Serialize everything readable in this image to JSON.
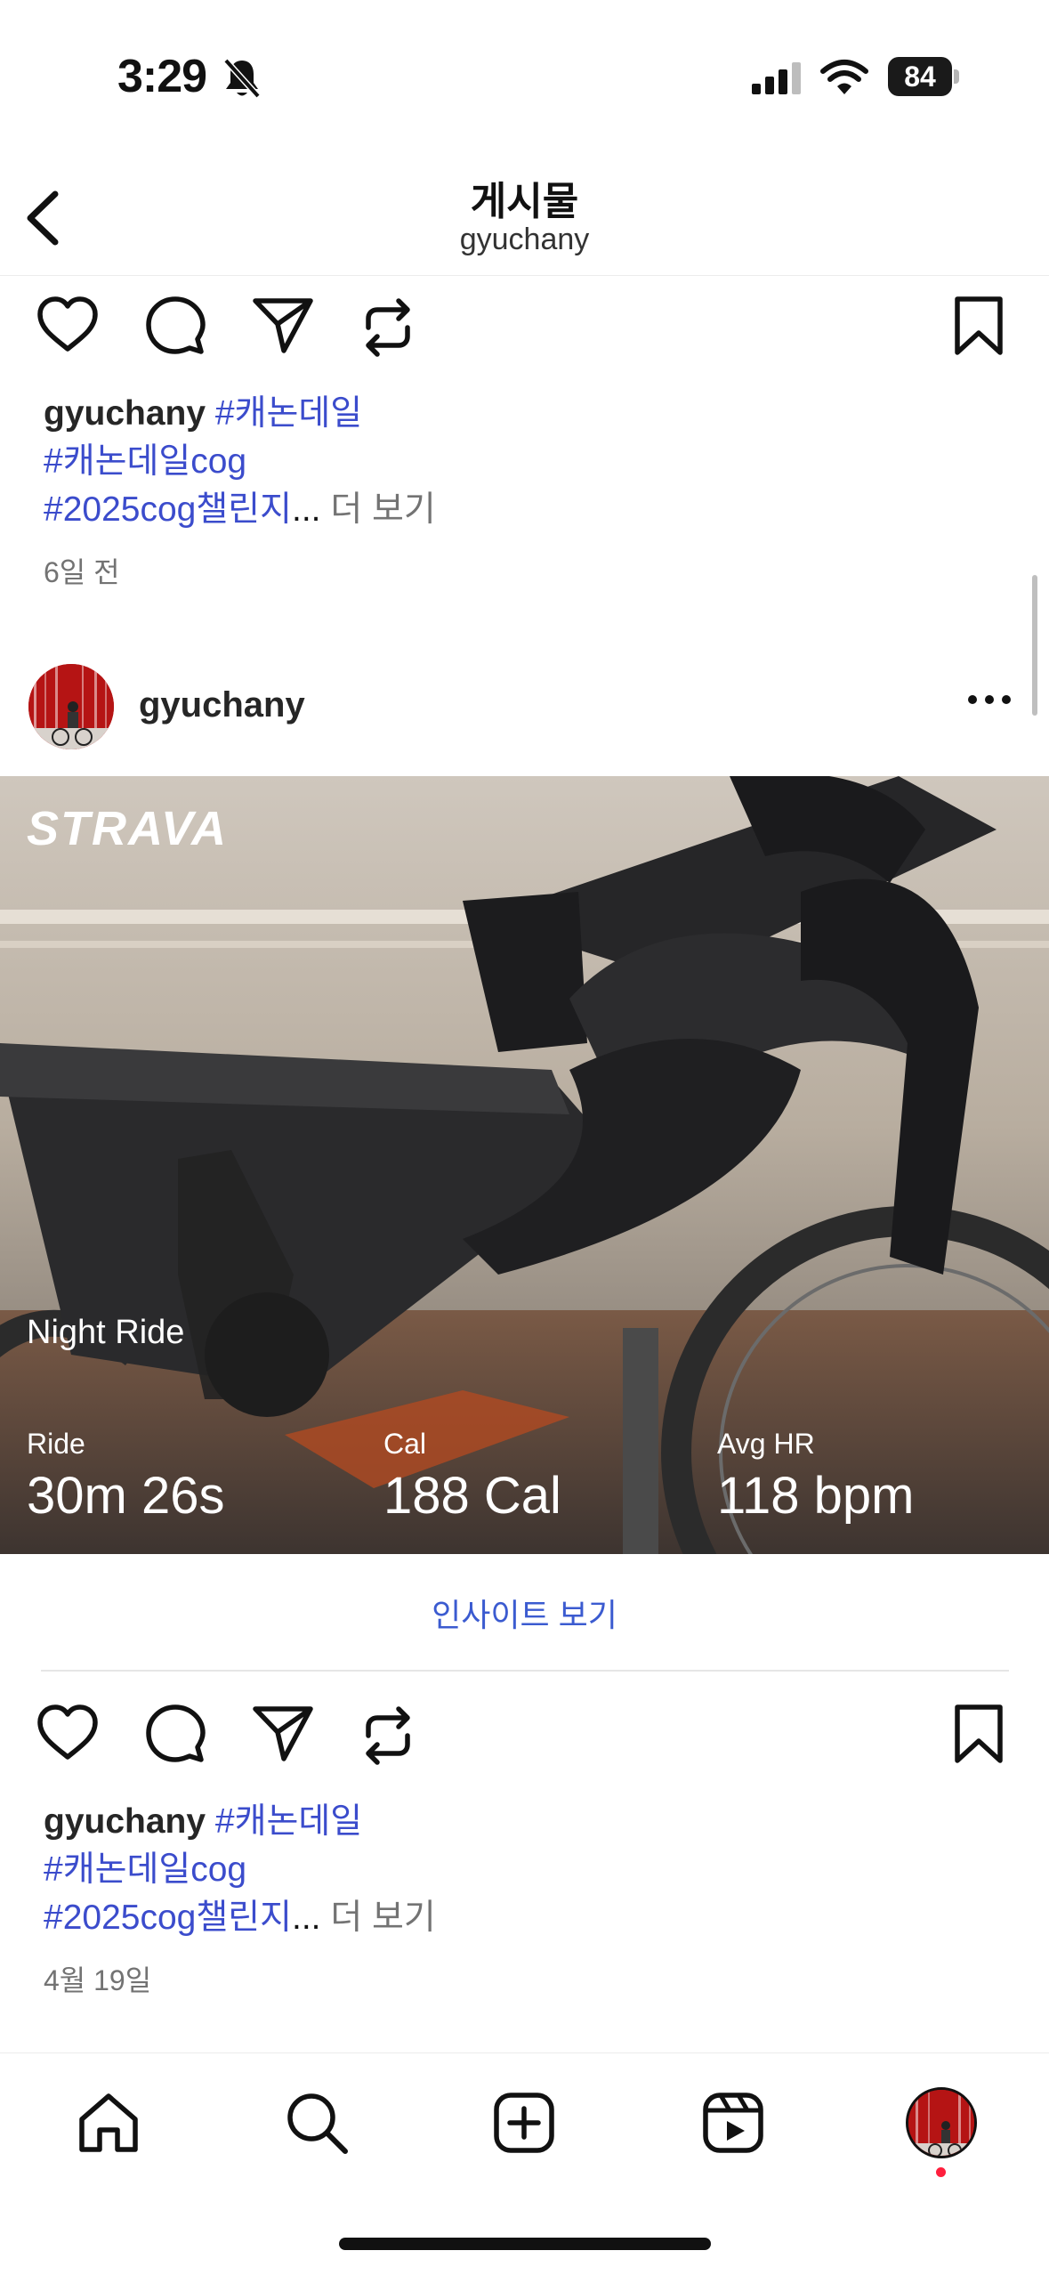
{
  "status_bar": {
    "time": "3:29",
    "battery": "84"
  },
  "header": {
    "title": "게시물",
    "subtitle": "gyuchany"
  },
  "post_top": {
    "caption": {
      "user": "gyuchany",
      "tag1": "#캐논데일",
      "tag2": "#캐논데일cog",
      "tag3": "#2025cog챌린지",
      "ellipsis": "...",
      "more": " 더 보기"
    },
    "date": "6일 전"
  },
  "post_main": {
    "user": "gyuchany",
    "photo": {
      "logo": "STRAVA",
      "ride_name": "Night Ride",
      "stats": [
        {
          "label": "Ride",
          "value": "30m 26s"
        },
        {
          "label": "Cal",
          "value": "188 Cal"
        },
        {
          "label": "Avg HR",
          "value": "118 bpm"
        }
      ]
    },
    "insights_link": "인사이트 보기",
    "caption": {
      "user": "gyuchany",
      "tag1": "#캐논데일",
      "tag2": "#캐논데일cog",
      "tag3": "#2025cog챌린지",
      "ellipsis": "...",
      "more": " 더 보기"
    },
    "date": "4월 19일"
  },
  "tab_bar": {
    "items": [
      "home-icon",
      "search-icon",
      "create-icon",
      "reels-icon",
      "profile-avatar"
    ]
  }
}
